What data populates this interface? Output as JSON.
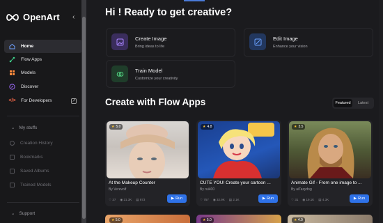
{
  "app": {
    "name": "OpenArt"
  },
  "sidebar": {
    "collapse_glyph": "‹",
    "items": [
      {
        "label": "Home",
        "icon": "home-icon",
        "active": true
      },
      {
        "label": "Flow Apps",
        "icon": "flow-apps-icon"
      },
      {
        "label": "Models",
        "icon": "models-icon"
      },
      {
        "label": "Discover",
        "icon": "discover-icon"
      },
      {
        "label": "For Developers",
        "icon": "code-icon"
      }
    ],
    "my_stuffs": {
      "label": "My stuffs",
      "items": [
        "Creation History",
        "Bookmarks",
        "Saved Albums",
        "Trained Models"
      ]
    },
    "support": "Support"
  },
  "main": {
    "greeting": "Hi ! Ready to get creative?",
    "quick_actions": [
      {
        "title": "Create Image",
        "subtitle": "Bring ideas to life",
        "icon": "image-icon",
        "color": "#8a5cf5"
      },
      {
        "title": "Edit Image",
        "subtitle": "Enhance your vision",
        "icon": "edit-image-icon",
        "color": "#3c7ff5"
      },
      {
        "title": "Train Model",
        "subtitle": "Customize your creativity",
        "icon": "brain-icon",
        "color": "#3fbf6a"
      }
    ],
    "flow_heading": "Create with Flow Apps",
    "filters": {
      "featured": "Featured",
      "latest": "Latest"
    },
    "cards": [
      {
        "rating": "5.0",
        "title": "At the Makeup Counter",
        "by": "By Verevolf",
        "likes": "37",
        "views": "21.3K",
        "runs": "873",
        "run_label": "Run"
      },
      {
        "rating": "4.8",
        "title": "CUTE YOU!   Create your cartoon ...",
        "by": "By rui400",
        "likes": "757",
        "views": "32.9K",
        "runs": "2.1K",
        "run_label": "Run"
      },
      {
        "rating": "3.5",
        "title": "Animate Gif - From one image to ...",
        "by": "By aiTazydog",
        "likes": "31",
        "views": "19.1K",
        "runs": "4.3K",
        "run_label": "Run"
      }
    ],
    "peek_ratings": [
      "5.0",
      "5.0",
      "4.0"
    ],
    "accent": "#2f72e8"
  }
}
